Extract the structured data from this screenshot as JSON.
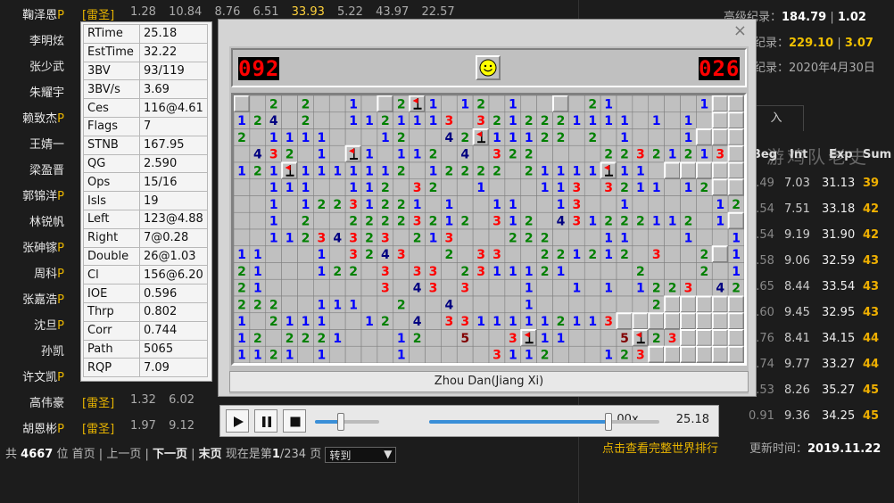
{
  "ranking": {
    "rows": [
      {
        "name": "鞠泽恩",
        "pro": true,
        "tag": "雷圣",
        "vals": [
          "1.28",
          "10.84",
          "8.76",
          "6.51",
          "33.93",
          "5.22",
          "43.97",
          "22.57"
        ],
        "hi": 4
      },
      {
        "name": "李明炫",
        "pro": false
      },
      {
        "name": "张少武",
        "pro": false
      },
      {
        "name": "朱耀宇",
        "pro": false
      },
      {
        "name": "赖致杰",
        "pro": true
      },
      {
        "name": "王婧一",
        "pro": false
      },
      {
        "name": "梁盈晋",
        "pro": false
      },
      {
        "name": "郭锦洋",
        "pro": true
      },
      {
        "name": "林锐帆",
        "pro": false
      },
      {
        "name": "张砷镓",
        "pro": true
      },
      {
        "name": "周科",
        "pro": true
      },
      {
        "name": "张嘉浩",
        "pro": true
      },
      {
        "name": "沈旦",
        "pro": true
      },
      {
        "name": "孙凯",
        "pro": false
      },
      {
        "name": "许文凯",
        "pro": true
      },
      {
        "name": "高伟豪",
        "pro": false,
        "tag": "雷圣",
        "vals": [
          "1.32",
          "6.02"
        ]
      },
      {
        "name": "胡恩彬",
        "pro": true,
        "tag": "雷圣",
        "vals": [
          "1.97",
          "9.12"
        ]
      }
    ],
    "pro_suffix": "P"
  },
  "pager": {
    "total_prefix": "共",
    "total": "4667",
    "total_suffix": "位",
    "first": "首页",
    "prev": "上一页",
    "next": "下一页",
    "last": "末页",
    "now_prefix": "现在是第",
    "page": "1",
    "pages": "/234",
    "now_suffix": "页",
    "goto": "转到"
  },
  "right_panel": {
    "record1_label": "高级纪录：",
    "record1_a": "184.79",
    "record1_b": "1.02",
    "record2_label": "纪录：",
    "record2_a": "229.10",
    "record2_b": "3.07",
    "record3_label": "纪录：",
    "record3_value": "2020年4月30日",
    "tab_label": "入",
    "headers": [
      "Beg",
      "Int",
      "Exp",
      "Sum"
    ],
    "watermark": "游鸡队老史",
    "rows": [
      [
        "0.49",
        "7.03",
        "31.13",
        "39"
      ],
      [
        "1.54",
        "7.51",
        "33.18",
        "42"
      ],
      [
        "1.54",
        "9.19",
        "31.90",
        "42"
      ],
      [
        "1.58",
        "9.06",
        "32.59",
        "43"
      ],
      [
        "1.65",
        "8.44",
        "33.54",
        "43"
      ],
      [
        "1.60",
        "9.45",
        "32.95",
        "43"
      ],
      [
        "1.76",
        "8.41",
        "34.15",
        "44"
      ],
      [
        "1.74",
        "9.77",
        "33.27",
        "44"
      ],
      [
        "1.53",
        "8.26",
        "35.27",
        "45"
      ],
      [
        "0.91",
        "9.36",
        "34.25",
        "45"
      ]
    ],
    "more_link": "点击查看完整世界排行",
    "update_label": "更新时间：",
    "update_date": "2019.11.22"
  },
  "stats": [
    [
      "RTime",
      "25.18"
    ],
    [
      "EstTime",
      "32.22"
    ],
    [
      "3BV",
      "93/119"
    ],
    [
      "3BV/s",
      "3.69"
    ],
    [
      "Ces",
      "116@4.61"
    ],
    [
      "Flags",
      "7"
    ],
    [
      "STNB",
      "167.95"
    ],
    [
      "QG",
      "2.590"
    ],
    [
      "Ops",
      "15/16"
    ],
    [
      "Isls",
      "19"
    ],
    [
      "Left",
      "123@4.88"
    ],
    [
      "Right",
      "7@0.28"
    ],
    [
      "Double",
      "26@1.03"
    ],
    [
      "Cl",
      "156@6.20"
    ],
    [
      "IOE",
      "0.596"
    ],
    [
      "Thrp",
      "0.802"
    ],
    [
      "Corr",
      "0.744"
    ],
    [
      "Path",
      "5065"
    ],
    [
      "RQP",
      "7.09"
    ]
  ],
  "game": {
    "close_icon": "×",
    "mines_left": "092",
    "timer": "026",
    "face": "smiley",
    "player": "Zhou Dan(Jiang Xi)",
    "board": [
      "#.2.2..1.#2F1.12.1..#.21.....1##",
      "124.2..1121113.3212221111.1.1.##",
      "2.1111...12..42F11122.2.1...1###",
      ".432.1.F1.112.4.322....22321213#",
      "121F1111112.12222.21111F11.#####",
      "..111..112.32..1...113.3211.12##",
      "..1.12231221.1..11..13..1.....12",
      "..1.2..22223212.312.431222112.1#",
      "..11234323.213...222...11...1..1",
      "11...1.3243..2.33..221212.3..2#1",
      "21...122.3.33.2311121....2...2.1",
      "21.......3.43.3...1..1.1.1223.422",
      "222..111..2..4....1.......2#####",
      "1.2111..12.4.33111112113########",
      "12.2221...12..5..3F11...5F23####",
      "1121.1....1.....3112...123######"
    ]
  },
  "replay": {
    "play_icon": "play",
    "pause_icon": "pause",
    "stop_icon": "stop",
    "speed": "1.00x",
    "speed_level": 0.4,
    "progress": 0.78,
    "time": "25.18"
  }
}
